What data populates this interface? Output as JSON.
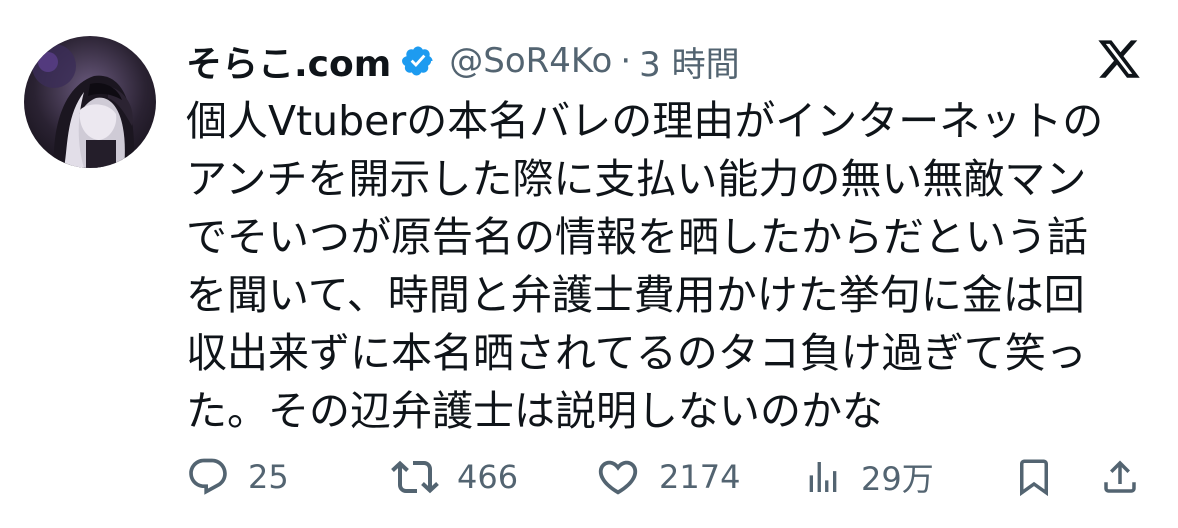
{
  "author": {
    "display_name": "そらこ.com",
    "handle": "@SoR4Ko",
    "separator": "·",
    "time": "3 時間",
    "verified": true,
    "verified_color": "#1d9bf0"
  },
  "tweet": {
    "lines": [
      "個人Vtuberの本名バレの理由がインターネットの",
      "アンチを開示した際に支払い能力の無い無敵マン",
      "でそいつが原告名の情報を晒したからだという話",
      "を聞いて、時間と弁護士費用かけた挙句に金は回",
      "収出来ずに本名晒されてるのタコ負け過ぎて笑っ",
      "た。その辺弁護士は説明しないのかな"
    ]
  },
  "actions": {
    "replies": "25",
    "reposts": "466",
    "likes": "2174",
    "views": "29万"
  },
  "icons": {
    "logo": "x-logo-icon",
    "reply": "reply-icon",
    "repost": "repost-icon",
    "like": "heart-icon",
    "views": "views-icon",
    "bookmark": "bookmark-icon",
    "share": "share-icon"
  },
  "colors": {
    "text": "#0f1419",
    "secondary": "#536471"
  }
}
